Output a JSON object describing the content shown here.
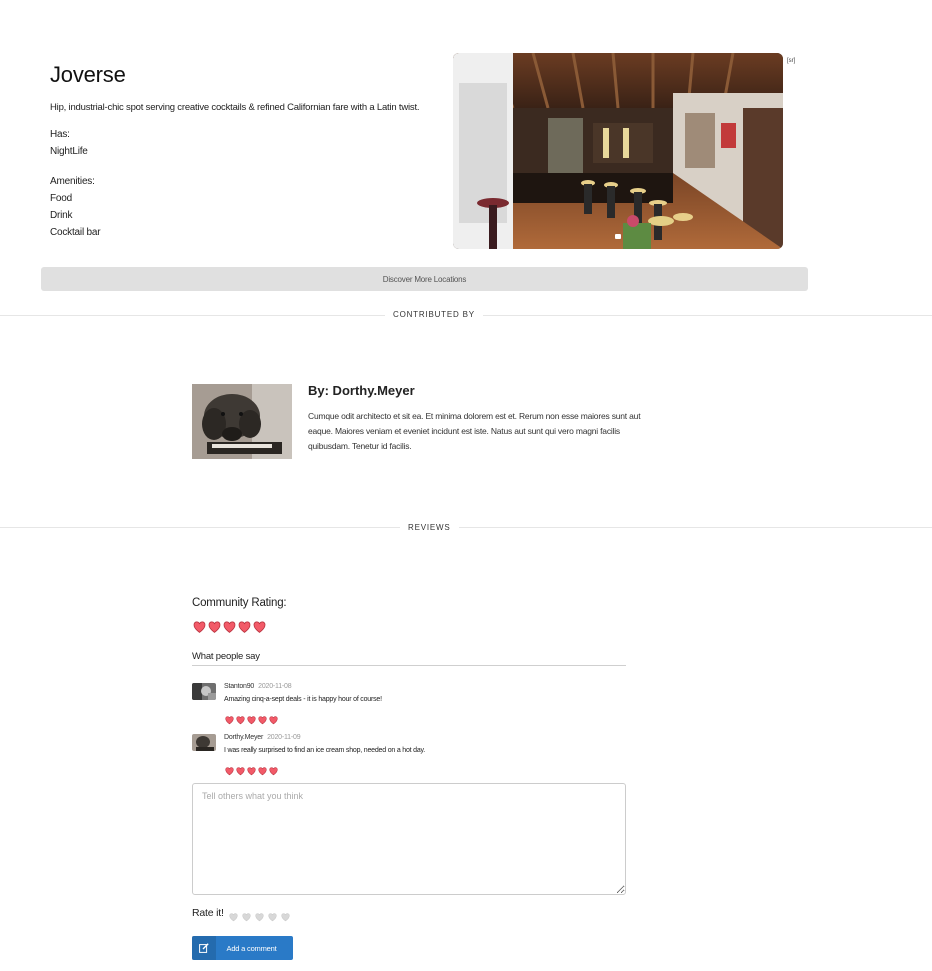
{
  "location": {
    "title": "Joverse",
    "description": "Hip, industrial-chic spot serving creative cocktails & refined Californian fare with a Latin twist.",
    "has_label": "Has:",
    "has_value": "NightLife",
    "amenities_label": "Amenities:",
    "amenities": [
      "Food",
      "Drink",
      "Cocktail bar"
    ]
  },
  "carousel": {
    "image": "restaurant-interior-photo",
    "slide_count": 1,
    "control_text": "[sr]"
  },
  "discover_button": "Discover More Locations",
  "sections": {
    "contributed_by": "CONTRIBUTED BY",
    "reviews": "REVIEWS"
  },
  "contributor": {
    "name": "By: Dorthy.Meyer",
    "bio": "Cumque odit architecto et sit ea. Et minima dolorem est et. Rerum non esse maiores sunt aut eaque. Maiores veniam et eveniet incidunt est iste. Natus aut sunt qui vero magni facilis quibusdam. Tenetur id facilis."
  },
  "reviews": {
    "community_label": "Community Rating:",
    "community_rating": 5,
    "what_people_say": "What people say",
    "items": [
      {
        "author": "Stanton90",
        "date": "2020-11-08",
        "text": "Amazing cinq-a-sept deals - it is happy hour of course!",
        "rating": 5
      },
      {
        "author": "Dorthy.Meyer",
        "date": "2020-11-09",
        "text": "I was really surprised to find an ice cream shop, needed on a hot day.",
        "rating": 5
      }
    ],
    "comment_placeholder": "Tell others what you think",
    "rate_label": "Rate it!",
    "rate_value": 0,
    "add_button": "Add a comment"
  },
  "colors": {
    "heart_active": "#f25a68",
    "heart_inactive": "#d8d8d8",
    "button_primary": "#2a7ac7",
    "button_secondary": "#e0e0e0"
  },
  "icons": {
    "rating": "heart-icon",
    "add_comment": "edit-icon"
  }
}
